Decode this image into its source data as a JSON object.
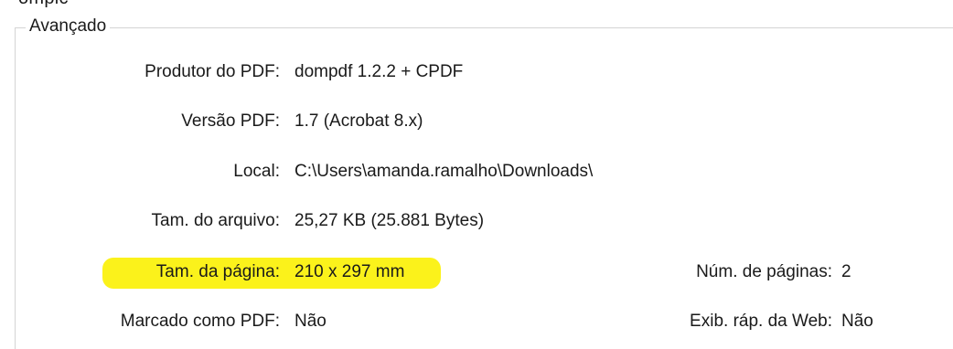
{
  "window": {
    "cut_text": "ompic"
  },
  "group": {
    "title": "Avançado"
  },
  "fields": {
    "producer": {
      "label": "Produtor do PDF:",
      "value": "dompdf 1.2.2 + CPDF"
    },
    "version": {
      "label": "Versão PDF:",
      "value": "1.7 (Acrobat 8.x)"
    },
    "location": {
      "label": "Local:",
      "value": "C:\\Users\\amanda.ramalho\\Downloads\\"
    },
    "file_size": {
      "label": "Tam. do arquivo:",
      "value": "25,27 KB (25.881 Bytes)"
    },
    "page_size": {
      "label": "Tam. da página:",
      "value": "210 x 297 mm"
    },
    "page_count": {
      "label": "Núm. de páginas:",
      "value": "2"
    },
    "tagged": {
      "label": "Marcado como PDF:",
      "value": "Não"
    },
    "fast_web_view": {
      "label": "Exib. ráp. da Web:",
      "value": "Não"
    }
  },
  "colors": {
    "highlight": "#fbf21b",
    "border": "#d4d4d4"
  }
}
